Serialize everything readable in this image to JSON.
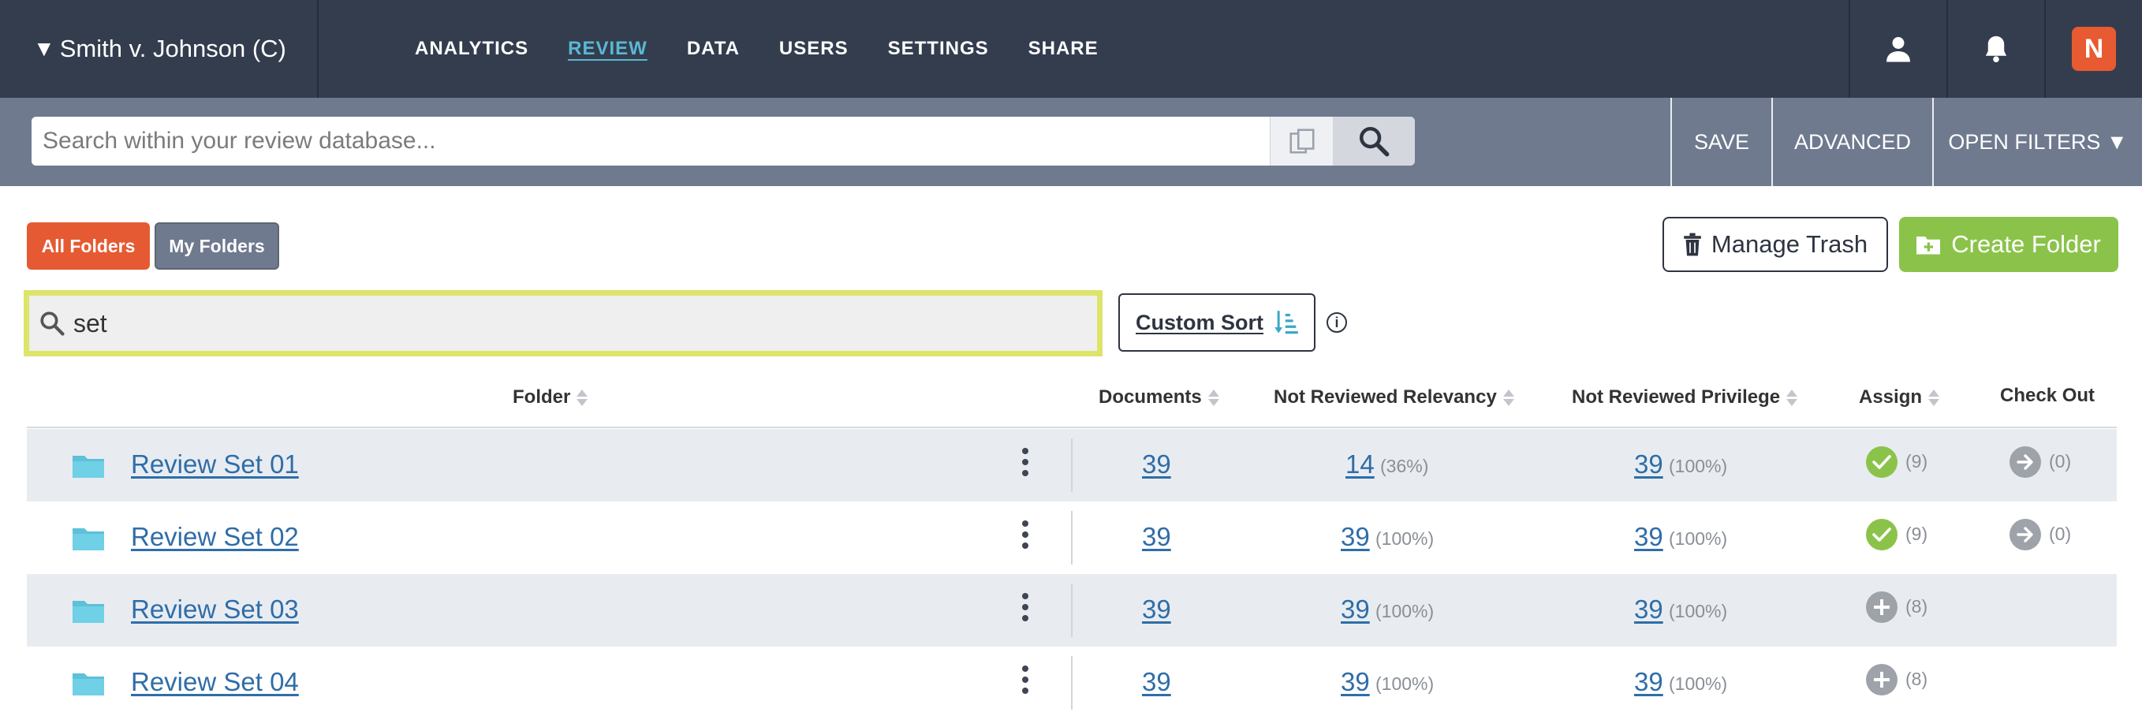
{
  "case": {
    "caret": "▼",
    "name": "Smith v. Johnson (C)"
  },
  "nav": [
    "ANALYTICS",
    "REVIEW",
    "DATA",
    "USERS",
    "SETTINGS",
    "SHARE"
  ],
  "nav_active": "REVIEW",
  "header_icons": [
    "user-icon",
    "bell-icon"
  ],
  "logo_text": "N",
  "search": {
    "placeholder": "Search within your review database...",
    "value": ""
  },
  "search_actions": {
    "save": "SAVE",
    "advanced": "ADVANCED",
    "open_filters": "OPEN FILTERS ▼"
  },
  "folder_tabs": {
    "all": "All Folders",
    "mine": "My Folders"
  },
  "buttons": {
    "manage_trash": "Manage Trash",
    "create_folder": "Create Folder"
  },
  "filter": {
    "value": "set"
  },
  "sort": {
    "label": "Custom Sort",
    "info": "i"
  },
  "columns": {
    "folder": "Folder",
    "documents": "Documents",
    "nr_relevancy": "Not Reviewed Relevancy",
    "nr_privilege": "Not Reviewed Privilege",
    "assign": "Assign",
    "checkout": "Check Out"
  },
  "rows": [
    {
      "name": "Review Set 01",
      "documents": "39",
      "rel": "14",
      "rel_pct": "(36%)",
      "priv": "39",
      "priv_pct": "(100%)",
      "assign_state": "check",
      "assign_count": "(9)",
      "checkout_count": "(0)"
    },
    {
      "name": "Review Set 02",
      "documents": "39",
      "rel": "39",
      "rel_pct": "(100%)",
      "priv": "39",
      "priv_pct": "(100%)",
      "assign_state": "check",
      "assign_count": "(9)",
      "checkout_count": "(0)"
    },
    {
      "name": "Review Set 03",
      "documents": "39",
      "rel": "39",
      "rel_pct": "(100%)",
      "priv": "39",
      "priv_pct": "(100%)",
      "assign_state": "plus",
      "assign_count": "(8)",
      "checkout_count": ""
    },
    {
      "name": "Review Set 04",
      "documents": "39",
      "rel": "39",
      "rel_pct": "(100%)",
      "priv": "39",
      "priv_pct": "(100%)",
      "assign_state": "plus",
      "assign_count": "(8)",
      "checkout_count": ""
    }
  ],
  "colors": {
    "nav_bg": "#343d4e",
    "search_bg": "#6f7a8f",
    "accent": "#5ab8d4",
    "all_folders": "#e55a33",
    "my_folders": "#6f7a8f",
    "create": "#8bc34a",
    "check": "#8bc34a",
    "link": "#2f6da8",
    "highlight": "#dde46a"
  }
}
